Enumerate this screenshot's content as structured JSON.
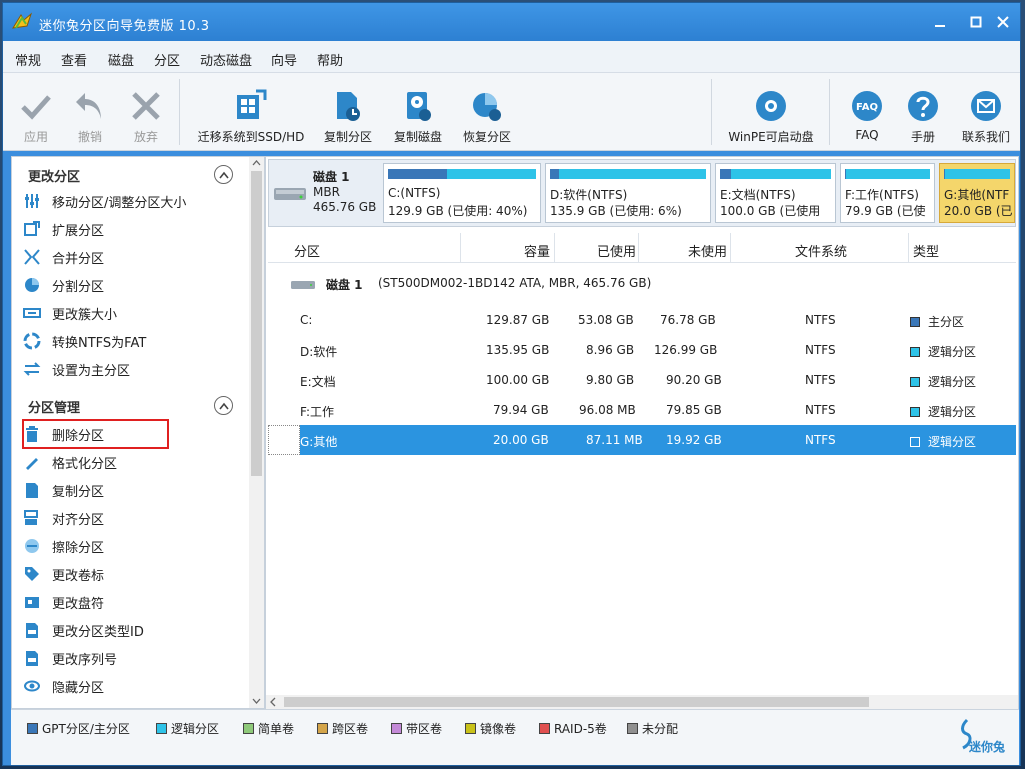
{
  "window": {
    "title": "迷你兔分区向导免费版 10.3"
  },
  "menu": [
    "常规",
    "查看",
    "磁盘",
    "分区",
    "动态磁盘",
    "向导",
    "帮助"
  ],
  "toolbar": {
    "apply": "应用",
    "undo": "撤销",
    "discard": "放弃",
    "migrate": "迁移系统到SSD/HD",
    "copy_partition": "复制分区",
    "copy_disk": "复制磁盘",
    "recover": "恢复分区",
    "winpe": "WinPE可启动盘",
    "faq": "FAQ",
    "manual": "手册",
    "contact": "联系我们",
    "faq_icon_text": "FAQ"
  },
  "sidebar": {
    "section1": "更改分区",
    "items1": [
      "移动分区/调整分区大小",
      "扩展分区",
      "合并分区",
      "分割分区",
      "更改簇大小",
      "转换NTFS为FAT",
      "设置为主分区"
    ],
    "section2": "分区管理",
    "items2": [
      "删除分区",
      "格式化分区",
      "复制分区",
      "对齐分区",
      "擦除分区",
      "更改卷标",
      "更改盘符",
      "更改分区类型ID",
      "更改序列号",
      "隐藏分区"
    ]
  },
  "diskmap": {
    "disk_name": "磁盘 1",
    "disk_type": "MBR",
    "disk_size": "465.76 GB",
    "parts": [
      {
        "l1": "C:(NTFS)",
        "l2": "129.9 GB (已使用: 40%)",
        "used": 0.4
      },
      {
        "l1": "D:软件(NTFS)",
        "l2": "135.9 GB (已使用: 6%)",
        "used": 0.06
      },
      {
        "l1": "E:文档(NTFS)",
        "l2": "100.0 GB (已使用",
        "used": 0.1
      },
      {
        "l1": "F:工作(NTFS)",
        "l2": "79.9 GB (已使",
        "used": 0.01
      },
      {
        "l1": "G:其他(NTF",
        "l2": "20.0 GB (已",
        "used": 0.01
      }
    ]
  },
  "table": {
    "headers": [
      "分区",
      "容量",
      "已使用",
      "未使用",
      "文件系统",
      "类型"
    ],
    "disk_row": {
      "name": "磁盘 1",
      "detail": "(ST500DM002-1BD142 ATA, MBR, 465.76 GB)"
    },
    "rows": [
      {
        "part": "C:",
        "cap": "129.87 GB",
        "used": "53.08 GB",
        "free": "76.78 GB",
        "fs": "NTFS",
        "type": "主分区"
      },
      {
        "part": "D:软件",
        "cap": "135.95 GB",
        "used": "8.96 GB",
        "free": "126.99 GB",
        "fs": "NTFS",
        "type": "逻辑分区"
      },
      {
        "part": "E:文档",
        "cap": "100.00 GB",
        "used": "9.80 GB",
        "free": "90.20 GB",
        "fs": "NTFS",
        "type": "逻辑分区"
      },
      {
        "part": "F:工作",
        "cap": "79.94 GB",
        "used": "96.08 MB",
        "free": "79.85 GB",
        "fs": "NTFS",
        "type": "逻辑分区"
      },
      {
        "part": "G:其他",
        "cap": "20.00 GB",
        "used": "87.11 MB",
        "free": "19.92 GB",
        "fs": "NTFS",
        "type": "逻辑分区"
      }
    ]
  },
  "legend": [
    "GPT分区/主分区",
    "逻辑分区",
    "简单卷",
    "跨区卷",
    "带区卷",
    "镜像卷",
    "RAID-5卷",
    "未分配"
  ],
  "brand": "迷你兔",
  "colors": {
    "primary": "#3a77b8",
    "logical": "#2ec3e8",
    "simple": "#8ec97a",
    "spanned": "#d4a54a",
    "striped": "#c48ad8",
    "mirrored": "#c9c21a",
    "raid5": "#e05050",
    "unallocated": "#909090",
    "highlight": "#2b94e0",
    "alert": "#e02020"
  }
}
